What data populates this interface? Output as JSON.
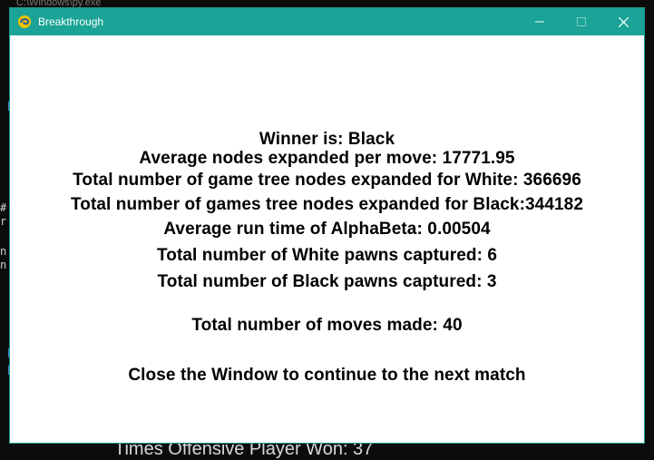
{
  "background": {
    "console_title": "C:\\Windows\\py.exe",
    "bottom_text": "Times Offensive Player Won: 37",
    "left_glyphs": [
      "#",
      "r",
      "n",
      "n"
    ]
  },
  "window": {
    "title": "Breakthrough",
    "icon": "pygame-snake-icon",
    "titlebar_color": "#1aa396",
    "controls": {
      "minimize": "minimize-icon",
      "maximize": "maximize-icon",
      "close": "close-icon"
    }
  },
  "results": {
    "winner": "Winner is: Black",
    "avg_nodes": "Average nodes expanded per move: 17771.95",
    "white_nodes": "Total number of game tree nodes expanded for White: 366696",
    "black_nodes": "Total number of games tree nodes expanded for Black:344182",
    "avg_runtime": "Average run time of AlphaBeta: 0.00504",
    "white_captured": "Total number of White pawns captured: 6",
    "black_captured": "Total number of Black pawns captured: 3",
    "total_moves": "Total number of moves made: 40",
    "continue_msg": "Close the Window to continue to the next match"
  }
}
